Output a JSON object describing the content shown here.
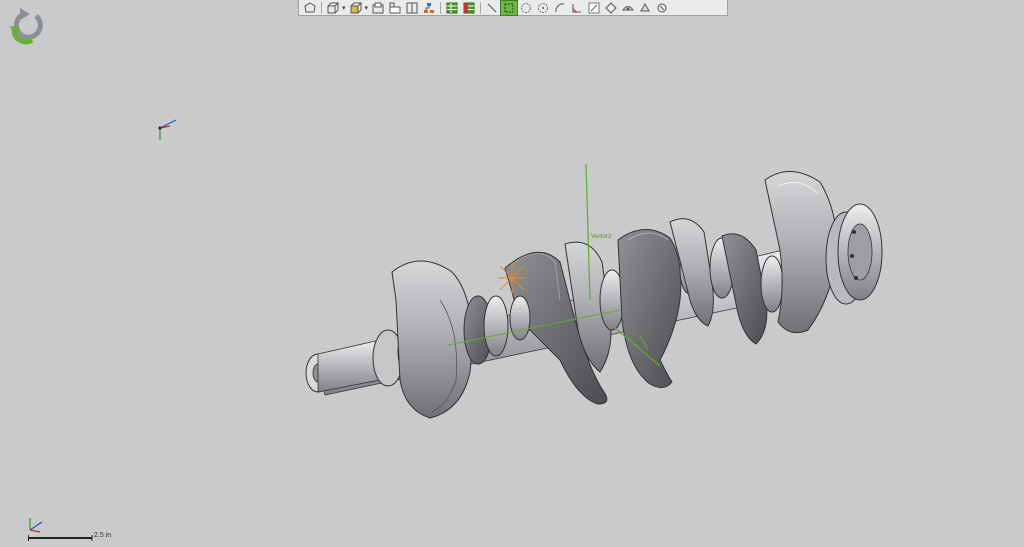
{
  "toolbar": {
    "buttons": [
      {
        "name": "view-orientation",
        "icon": "polygon-icon"
      },
      {
        "name": "display-style-shaded",
        "icon": "cube-icon"
      },
      {
        "name": "section-view",
        "icon": "section-cube-icon"
      },
      {
        "name": "view-front",
        "icon": "front-view-icon"
      },
      {
        "name": "view-top",
        "icon": "top-view-icon"
      },
      {
        "name": "view-split",
        "icon": "split-view-icon"
      },
      {
        "name": "assembly-tree",
        "icon": "tree-icon"
      },
      {
        "name": "grid-table",
        "icon": "grid-icon"
      },
      {
        "name": "grid-table-red",
        "icon": "grid-red-icon"
      },
      {
        "name": "sketch-line",
        "icon": "line-icon"
      },
      {
        "name": "select-box",
        "icon": "select-box-icon",
        "active": true
      },
      {
        "name": "measure-circle",
        "icon": "circle-icon"
      },
      {
        "name": "measure-point",
        "icon": "point-circle-icon"
      },
      {
        "name": "measure-arc",
        "icon": "arc-icon"
      },
      {
        "name": "measure-angle",
        "icon": "angle-icon"
      },
      {
        "name": "markup-pen",
        "icon": "pen-icon"
      },
      {
        "name": "markup-shape",
        "icon": "shape-icon"
      },
      {
        "name": "camera-view",
        "icon": "camera-icon"
      },
      {
        "name": "lighting",
        "icon": "light-icon"
      },
      {
        "name": "render",
        "icon": "render-icon"
      }
    ]
  },
  "viewport": {
    "scale_label": "2.5 in",
    "vector_label": "Vector2",
    "colors": {
      "background": "#c9cacb",
      "accent_green": "#66b032",
      "vector_green": "#5fae22",
      "vector_orange": "#f08a1e"
    }
  }
}
